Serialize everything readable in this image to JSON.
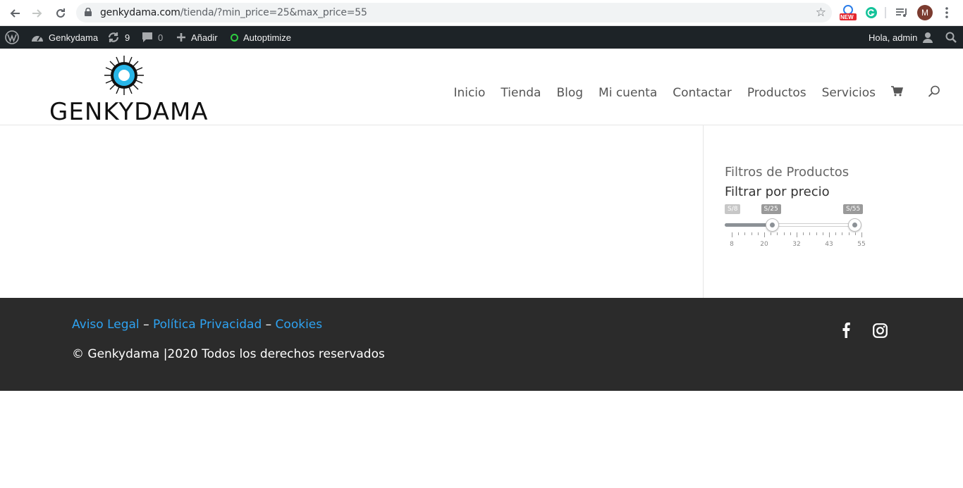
{
  "browser": {
    "url_host": "genkydama.com",
    "url_path": "/tienda/?min_price=25&max_price=55",
    "new_badge": "NEW",
    "profile_initial": "M"
  },
  "adminbar": {
    "site_name": "Genkydama",
    "updates_count": "9",
    "comments_count": "0",
    "add_label": "Añadir",
    "autoptimize_label": "Autoptimize",
    "greeting": "Hola, admin"
  },
  "header": {
    "logo_text": "GENKYDAMA",
    "menu": [
      {
        "label": "Inicio"
      },
      {
        "label": "Tienda"
      },
      {
        "label": "Blog"
      },
      {
        "label": "Mi cuenta"
      },
      {
        "label": "Contactar"
      },
      {
        "label": "Productos"
      },
      {
        "label": "Servicios"
      }
    ]
  },
  "sidebar": {
    "widget_title": "Filtros de Productos",
    "filter_title": "Filtrar por precio",
    "price_filter": {
      "range_min": 8,
      "range_max": 55,
      "selected_min": 25,
      "selected_max": 55,
      "min_label": "S/8",
      "from_label": "S/25",
      "to_label": "S/55",
      "ticks": [
        "8",
        "20",
        "32",
        "43",
        "55"
      ]
    }
  },
  "footer": {
    "link_legal": "Aviso Legal",
    "link_privacy": "Política Privacidad",
    "link_cookies": "Cookies",
    "separator": "–",
    "copyright": "© Genkydama |2020 Todos los derechos reservados"
  },
  "colors": {
    "adminbar_bg": "#1d2327",
    "footer_bg": "#2b2b2b",
    "link": "#2ea3f2",
    "logo_accent": "#29b6e8"
  }
}
